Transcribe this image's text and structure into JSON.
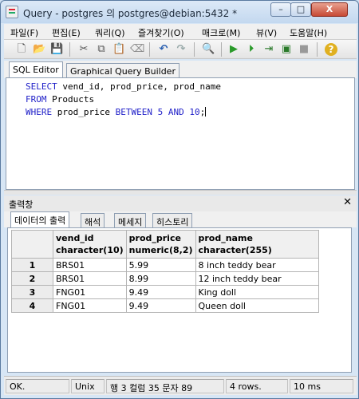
{
  "window": {
    "title": "Query - postgres 의 postgres@debian:5432 *",
    "min_label": "–",
    "max_label": "□",
    "close_label": "X"
  },
  "menu": [
    "파일(F)",
    "편집(E)",
    "쿼리(Q)",
    "즐겨찾기(O)",
    "매크로(M)",
    "뷰(V)",
    "도움말(H)"
  ],
  "toolbar": {
    "icons": [
      "new-file-icon",
      "open-folder-icon",
      "save-icon",
      "cut-icon",
      "copy-icon",
      "paste-icon",
      "clear-icon",
      "undo-icon",
      "redo-icon",
      "find-icon",
      "execute-icon",
      "explain-icon",
      "execute-to-file-icon",
      "execute-pgscript-icon",
      "stop-icon",
      "help-icon"
    ],
    "glyphs": [
      "🗋",
      "📂",
      "💾",
      "✂",
      "⧉",
      "📋",
      "⌫",
      "↶",
      "↷",
      "🔍",
      "▶",
      "⏵",
      "⇥",
      "▣",
      "■",
      "?"
    ]
  },
  "editor_tabs": [
    "SQL Editor",
    "Graphical Query Builder"
  ],
  "sql": {
    "line1": {
      "kw1": "SELECT",
      "rest": " vend_id, prod_price, prod_name"
    },
    "line2": {
      "kw1": "FROM",
      "rest": " Products"
    },
    "line3": {
      "kw1": "WHERE",
      "mid": " prod_price ",
      "kw2": "BETWEEN",
      "num1": "5",
      "kw3": "AND",
      "num2": "10",
      "end": ";"
    }
  },
  "output": {
    "title": "출력창",
    "close_label": "✕",
    "tabs": [
      "데이터의 출력",
      "해석",
      "메세지",
      "히스토리"
    ]
  },
  "grid": {
    "columns": [
      {
        "name": "vend_id",
        "type": "character(10)"
      },
      {
        "name": "prod_price",
        "type": "numeric(8,2)"
      },
      {
        "name": "prod_name",
        "type": "character(255)"
      }
    ],
    "rows": [
      {
        "num": "1",
        "cells": [
          "BRS01",
          "5.99",
          "8 inch teddy bear"
        ]
      },
      {
        "num": "2",
        "cells": [
          "BRS01",
          "8.99",
          "12 inch teddy bear"
        ]
      },
      {
        "num": "3",
        "cells": [
          "FNG01",
          "9.49",
          "King doll"
        ]
      },
      {
        "num": "4",
        "cells": [
          "FNG01",
          "9.49",
          "Queen doll"
        ]
      }
    ]
  },
  "status": {
    "state": "OK.",
    "line_ending": "Unix",
    "position": "행 3 컬럼 35 문자 89",
    "rows": "4 rows.",
    "time": "10 ms"
  },
  "colors": {
    "keyword": "#1f1fc8",
    "frame": "#d7e6f5",
    "close_button": "#c74a35"
  }
}
